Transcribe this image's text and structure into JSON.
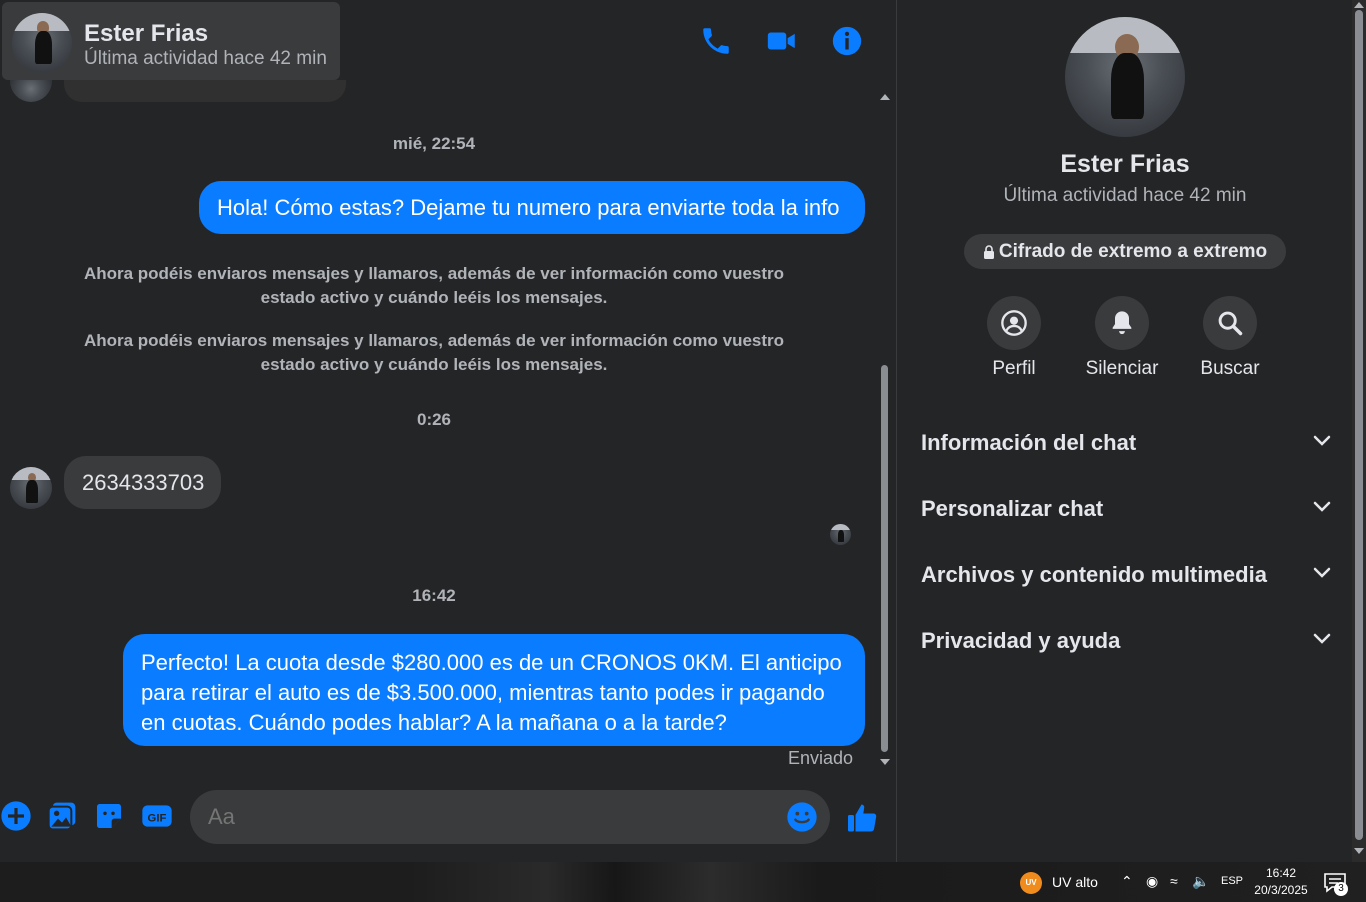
{
  "colors": {
    "accent": "#0a7cff",
    "background": "#242526",
    "bubble_in": "#3a3b3c",
    "uv_badge": "#f08c1e"
  },
  "header": {
    "name": "Ester Frias",
    "status": "Última actividad hace 42 min",
    "icons": [
      "phone-icon",
      "video-icon",
      "info-icon"
    ]
  },
  "messages": {
    "timestamp_1": "mié, 22:54",
    "outgoing_1": "Hola! Cómo estas? Dejame tu numero para enviarte toda la info",
    "system_1": "Ahora podéis enviaros mensajes y llamaros, además de ver información como vuestro estado activo y cuándo leéis los mensajes.",
    "system_2": "Ahora podéis enviaros mensajes y llamaros, además de ver información como vuestro estado activo y cuándo leéis los mensajes.",
    "timestamp_2": "0:26",
    "incoming_1": "2634333703",
    "timestamp_3": "16:42",
    "outgoing_2": "Perfecto! La cuota desde $280.000 es de un CRONOS 0KM. El anticipo para retirar el auto es de $3.500.000, mientras tanto podes ir pagando en cuotas. Cuándo podes hablar? A la mañana o a la tarde?",
    "status": "Enviado"
  },
  "composer": {
    "placeholder": "Aa",
    "icons": [
      "plus-icon",
      "photo-icon",
      "sticker-icon",
      "gif-icon",
      "emoji-icon",
      "like-icon"
    ]
  },
  "side": {
    "name": "Ester Frias",
    "status": "Última actividad hace 42 min",
    "e2e": "Cifrado de extremo a extremo",
    "actions": [
      {
        "label": "Perfil",
        "icon": "profile-icon"
      },
      {
        "label": "Silenciar",
        "icon": "bell-icon"
      },
      {
        "label": "Buscar",
        "icon": "search-icon"
      }
    ],
    "sections": [
      "Información del chat",
      "Personalizar chat",
      "Archivos y contenido multimedia",
      "Privacidad y ayuda"
    ]
  },
  "taskbar": {
    "uv_badge": "UV",
    "uv_label": "UV alto",
    "lang": "ESP",
    "time": "16:42",
    "date": "20/3/2025",
    "notifications": "3"
  }
}
